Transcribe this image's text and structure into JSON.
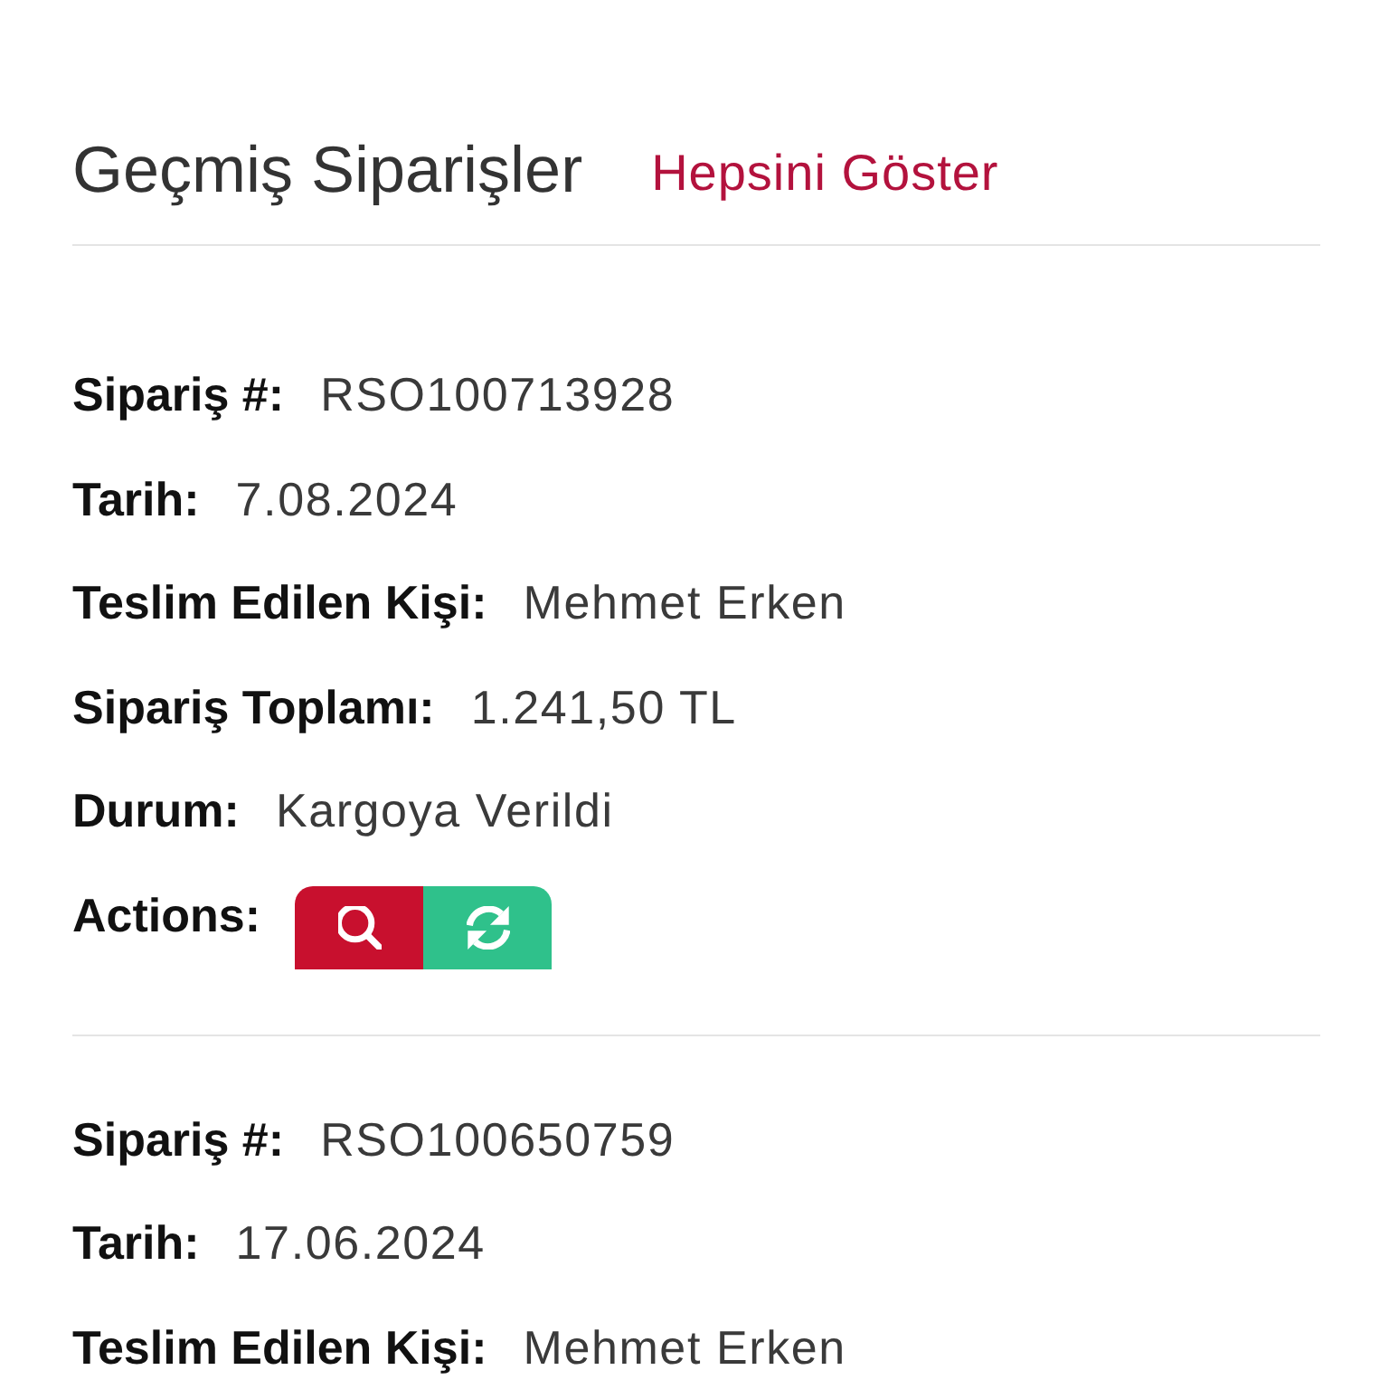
{
  "header": {
    "title": "Geçmiş Siparişler",
    "link": "Hepsini Göster"
  },
  "orders": [
    {
      "fields": [
        {
          "label": "Sipariş #:",
          "value": "RSO100713928"
        },
        {
          "label": "Tarih:",
          "value": "7.08.2024"
        },
        {
          "label": "Teslim Edilen Kişi:",
          "value": "Mehmet Erken"
        },
        {
          "label": "Sipariş Toplamı:",
          "value": "1.241,50 TL"
        },
        {
          "label": "Durum:",
          "value": "Kargoya Verildi"
        }
      ],
      "actions": {
        "label": "Actions:",
        "buttons": [
          {
            "kind": "search"
          },
          {
            "kind": "refresh"
          }
        ]
      }
    },
    {
      "fields": [
        {
          "label": "Sipariş #:",
          "value": "RSO100650759"
        },
        {
          "label": "Tarih:",
          "value": "17.06.2024"
        },
        {
          "label": "Teslim Edilen Kişi:",
          "value": "Mehmet Erken"
        }
      ]
    }
  ]
}
